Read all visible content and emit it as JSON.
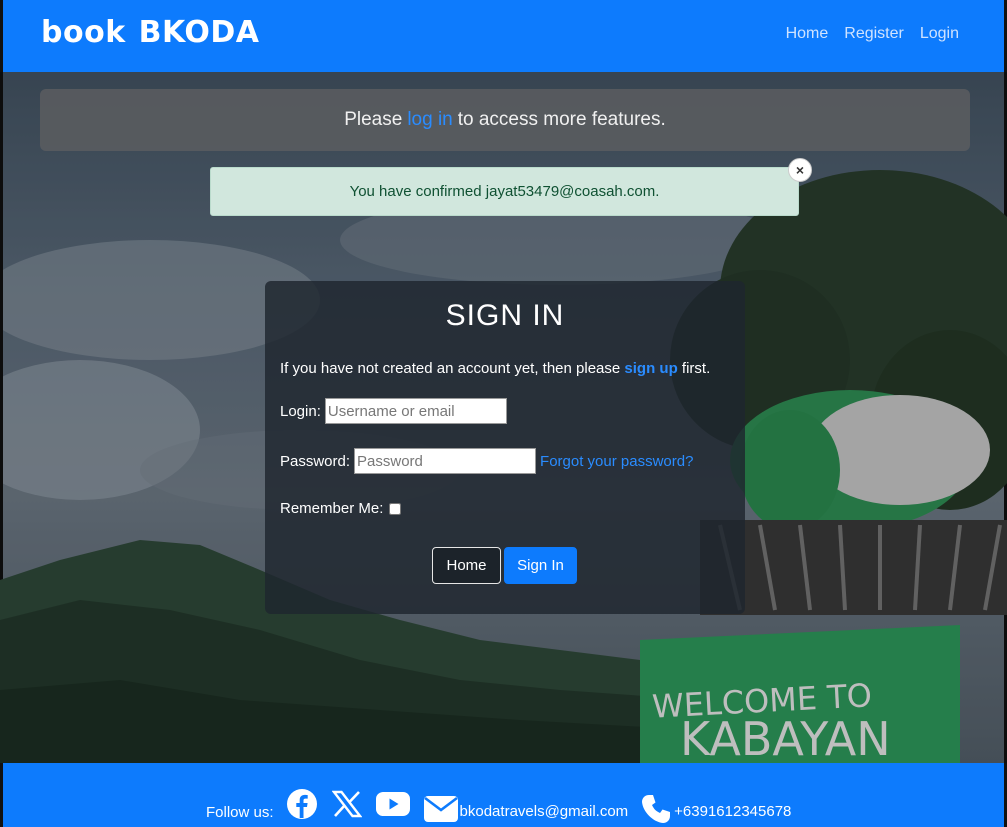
{
  "nav": {
    "brand_part1": "book",
    "brand_part2": "BKODA",
    "links": [
      "Home",
      "Register",
      "Login"
    ]
  },
  "info_banner": {
    "before": "Please",
    "link": "log in",
    "after": "to access more features."
  },
  "alert": {
    "message": "You have confirmed jayat53479@coasah.com.",
    "close": "×"
  },
  "signin": {
    "title": "SIGN IN",
    "intro_before": "If you have not created an account yet, then please",
    "intro_link": "sign up",
    "intro_after": "first.",
    "login_label": "Login:",
    "login_placeholder": "Username or email",
    "password_label": "Password:",
    "password_placeholder": "Password",
    "forgot_link": "Forgot your password?",
    "remember_label": "Remember Me:",
    "home_button": "Home",
    "signin_button": "Sign In"
  },
  "footer": {
    "follow_label": "Follow us:",
    "social_icons": [
      "facebook-icon",
      "x-icon",
      "youtube-icon"
    ],
    "email": "bkodatravels@gmail.com",
    "phone": "+6391612345678"
  },
  "background": {
    "sign_text_line1": "WELCOME TO",
    "sign_text_line2": "KABAYAN"
  },
  "colors": {
    "primary": "#0d7bfd",
    "alert_bg": "#d1e7dd",
    "alert_text": "#0f5132",
    "card_bg": "#1e262e"
  }
}
